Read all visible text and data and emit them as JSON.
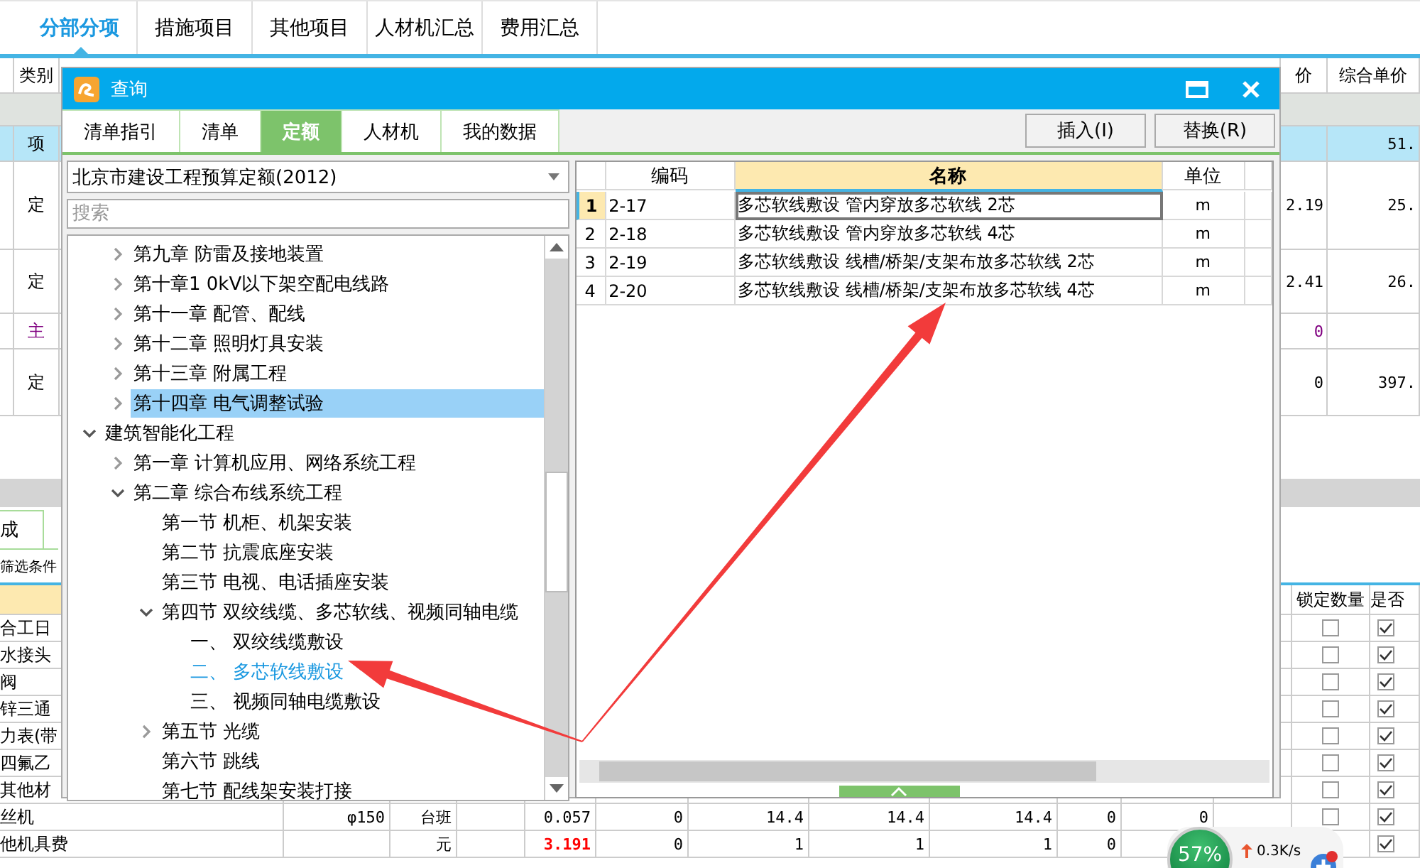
{
  "top_tabs": [
    {
      "label": "分部分项",
      "selected": true
    },
    {
      "label": "措施项目",
      "selected": false
    },
    {
      "label": "其他项目",
      "selected": false
    },
    {
      "label": "人材机汇总",
      "selected": false
    },
    {
      "label": "费用汇总",
      "selected": false
    }
  ],
  "main_grid": {
    "columns": [
      "类别",
      "价",
      "综合单价"
    ],
    "rows": [
      {
        "category": "项",
        "total": "51.",
        "selected": true,
        "color": "#000000"
      },
      {
        "category": "定",
        "price": "2.19",
        "total": "25.",
        "selected": false,
        "color": "#000000"
      },
      {
        "category": "定",
        "price": "2.41",
        "total": "26.",
        "selected": false,
        "color": "#000000"
      },
      {
        "category": "主",
        "price": "0",
        "selected": false,
        "color": "#800080"
      },
      {
        "category": "定",
        "price": "0",
        "total": "397.",
        "selected": false,
        "color": "#000000"
      }
    ]
  },
  "lower_panel": {
    "tab": "成",
    "filter_label": "筛选条件",
    "columns": [
      "锁定数量",
      "是否"
    ],
    "rows": [
      {
        "name": "合工日",
        "locked": false,
        "counted": true
      },
      {
        "name": "水接头",
        "locked": false,
        "counted": true
      },
      {
        "name": "阀",
        "locked": false,
        "counted": true
      },
      {
        "name": "锌三通",
        "locked": false,
        "counted": true
      },
      {
        "name": "力表(带",
        "locked": false,
        "counted": true
      },
      {
        "name": "四氟乙",
        "locked": false,
        "counted": true
      },
      {
        "name": "其他材",
        "locked": false,
        "counted": true
      },
      {
        "name": "丝机",
        "spec": "φ150",
        "unit": "台班",
        "quantity": "0.057",
        "column_6": "0",
        "column_7": "14.4",
        "column_8": "14.4",
        "column_9": "14.4",
        "column_10": "0",
        "column_11": "0",
        "quantity_changed": false,
        "locked": false,
        "counted": true
      },
      {
        "name": "他机具费",
        "unit": "元",
        "quantity": "3.191",
        "column_6": "0",
        "column_7": "1",
        "column_8": "1",
        "column_9": "1",
        "column_10": "0",
        "quantity_changed": true,
        "counted": true
      }
    ]
  },
  "dialog": {
    "title": "查询",
    "tabs": [
      {
        "label": "清单指引",
        "selected": false
      },
      {
        "label": "清单",
        "selected": false
      },
      {
        "label": "定额",
        "selected": true
      },
      {
        "label": "人材机",
        "selected": false
      },
      {
        "label": "我的数据",
        "selected": false
      }
    ],
    "buttons": [
      "插入(I)",
      "替换(R)"
    ],
    "quota_library": "北京市建设工程预算定额(2012)",
    "search": {
      "placeholder": "搜索"
    },
    "tree": {
      "continued_children": [
        {
          "label": "第九章 防雷及接地装置",
          "expanded": false,
          "selected": false,
          "current": false
        },
        {
          "label": "第十章1 0kV以下架空配电线路",
          "expanded": false,
          "selected": false,
          "current": false
        },
        {
          "label": "第十一章 配管、配线",
          "expanded": false,
          "selected": false,
          "current": false
        },
        {
          "label": "第十二章 照明灯具安装",
          "expanded": false,
          "selected": false,
          "current": false
        },
        {
          "label": "第十三章 附属工程",
          "expanded": false,
          "selected": false,
          "current": false
        },
        {
          "label": "第十四章 电气调整试验",
          "expanded": false,
          "selected": true,
          "current": false
        }
      ],
      "items": [
        {
          "label": "建筑智能化工程",
          "expanded": true,
          "selected": false,
          "current": false,
          "children": [
            {
              "label": "第一章 计算机应用、网络系统工程",
              "expanded": false,
              "selected": false,
              "current": false
            },
            {
              "label": "第二章 综合布线系统工程",
              "expanded": true,
              "selected": false,
              "current": false,
              "children": [
                {
                  "label": "第一节 机柜、机架安装",
                  "selected": false,
                  "current": false
                },
                {
                  "label": "第二节 抗震底座安装",
                  "selected": false,
                  "current": false
                },
                {
                  "label": "第三节 电视、电话插座安装",
                  "selected": false,
                  "current": false
                },
                {
                  "label": "第四节 双绞线缆、多芯软线、视频同轴电缆",
                  "expanded": true,
                  "selected": false,
                  "current": false,
                  "children": [
                    {
                      "label": "一、 双绞线缆敷设",
                      "selected": false,
                      "current": false
                    },
                    {
                      "label": "二、 多芯软线敷设",
                      "selected": false,
                      "current": true
                    },
                    {
                      "label": "三、 视频同轴电缆敷设",
                      "selected": false,
                      "current": false
                    }
                  ]
                },
                {
                  "label": "第五节 光缆",
                  "expanded": false,
                  "selected": false,
                  "current": false
                },
                {
                  "label": "第六节 跳线",
                  "selected": false,
                  "current": false
                },
                {
                  "label": "第七节 配线架安装打接",
                  "selected": false,
                  "current": false
                }
              ]
            }
          ]
        }
      ]
    },
    "results": {
      "columns": [
        {
          "label": "编码",
          "selected": false
        },
        {
          "label": "名称",
          "selected": true
        },
        {
          "label": "单位",
          "selected": false
        }
      ],
      "rows": [
        {
          "index": "1",
          "code": "2-17",
          "name": "多芯软线敷设 管内穿放多芯软线 2芯",
          "unit": "m",
          "selected": true
        },
        {
          "index": "2",
          "code": "2-18",
          "name": "多芯软线敷设 管内穿放多芯软线 4芯",
          "unit": "m",
          "selected": false
        },
        {
          "index": "3",
          "code": "2-19",
          "name": "多芯软线敷设 线槽/桥架/支架布放多芯软线 2芯",
          "unit": "m",
          "selected": false
        },
        {
          "index": "4",
          "code": "2-20",
          "name": "多芯软线敷设 线槽/桥架/支架布放多芯软线 4芯",
          "unit": "m",
          "selected": false
        }
      ]
    }
  },
  "speed_widget": {
    "percent": "57%",
    "upload": "0.3K/s"
  }
}
